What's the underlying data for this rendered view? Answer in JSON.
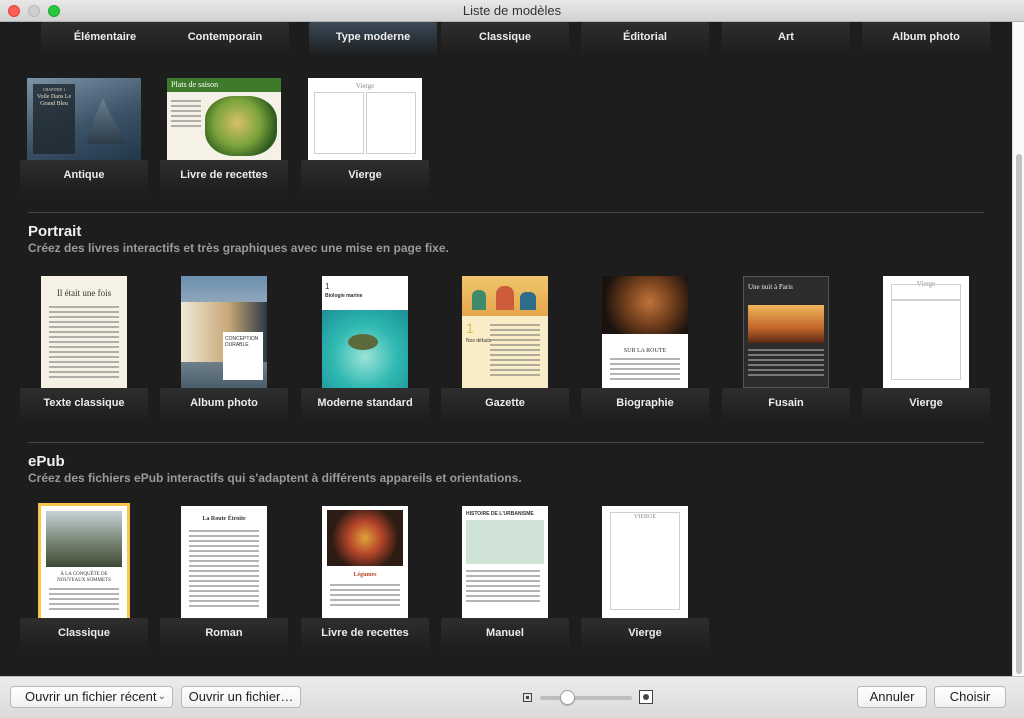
{
  "window": {
    "title": "Liste de modèles"
  },
  "top_row": [
    "Élémentaire",
    "Contemporain",
    "Type moderne",
    "Classique",
    "Éditorial",
    "Art",
    "Album photo"
  ],
  "landscape_row": [
    {
      "label": "Antique",
      "thumb_text": "Voile Dans Le Grand Bleu",
      "thumb_chapter": "CHAPITRE 1"
    },
    {
      "label": "Livre de recettes",
      "thumb_text": "Plats de saison"
    },
    {
      "label": "Vierge",
      "thumb_text": "Vierge"
    }
  ],
  "portrait": {
    "title": "Portrait",
    "subtitle": "Créez des livres interactifs et très graphiques avec une mise en page fixe.",
    "items": [
      {
        "label": "Texte classique",
        "thumb_text": "Il était une fois"
      },
      {
        "label": "Album photo",
        "thumb_text": "CONCEPTION DURABLE"
      },
      {
        "label": "Moderne standard",
        "thumb_text": "Biologie marine",
        "thumb_num": "1"
      },
      {
        "label": "Gazette",
        "thumb_text": "Nos débuts",
        "thumb_num": "1"
      },
      {
        "label": "Biographie",
        "thumb_text": "SUR LA ROUTE"
      },
      {
        "label": "Fusain",
        "thumb_text": "Une nuit à Paris"
      },
      {
        "label": "Vierge",
        "thumb_text": "Vierge"
      }
    ]
  },
  "epub": {
    "title": "ePub",
    "subtitle": "Créez des fichiers ePub interactifs qui s'adaptent à différents appareils et orientations.",
    "items": [
      {
        "label": "Classique",
        "thumb_text": "À LA CONQUÊTE DE NOUVEAUX SOMMETS"
      },
      {
        "label": "Roman",
        "thumb_text": "La Route Étroite"
      },
      {
        "label": "Livre de recettes",
        "thumb_text": "Légumes"
      },
      {
        "label": "Manuel",
        "thumb_text": "HISTOIRE DE L'URBANISME"
      },
      {
        "label": "Vierge",
        "thumb_text": "VIERGE"
      }
    ],
    "selected_index": 0
  },
  "bottom": {
    "open_recent": "Ouvrir un fichier récent",
    "open_file": "Ouvrir un fichier…",
    "cancel": "Annuler",
    "choose": "Choisir",
    "zoom_level": 0.3
  },
  "colors": {
    "selection": "#f5c54c",
    "background": "#1d1d1d"
  }
}
